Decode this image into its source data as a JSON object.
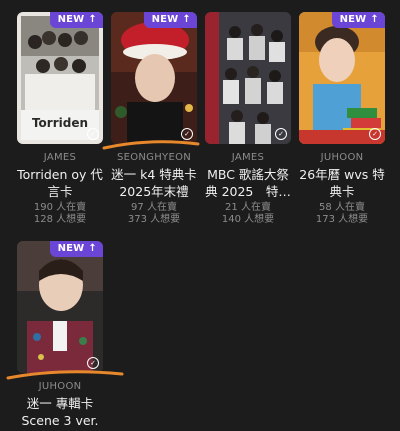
{
  "cards": [
    {
      "badge": "NEW",
      "badge_icon": "arrow-up",
      "member": "JAMES",
      "title": [
        "Torriden oy 代",
        "言卡"
      ],
      "trading": "190 人在賣",
      "wanting": "128 人想要",
      "photo_label": "Torriden"
    },
    {
      "badge": "NEW",
      "badge_icon": "arrow-up",
      "member": "SEONGHYEON",
      "title": [
        "迷一 k4 特典卡",
        "2025年末禮"
      ],
      "trading": "97 人在賣",
      "wanting": "373 人想要"
    },
    {
      "badge": "",
      "member": "JAMES",
      "title": [
        "MBC 歌謠大祭",
        "典 2025　特…"
      ],
      "trading": "21 人在賣",
      "wanting": "140 人想要"
    },
    {
      "badge": "NEW",
      "badge_icon": "arrow-up",
      "member": "JUHOON",
      "title": [
        "26年曆 wvs 特",
        "典卡"
      ],
      "trading": "58 人在賣",
      "wanting": "173 人想要"
    },
    {
      "badge": "NEW",
      "badge_icon": "arrow-up",
      "member": "JUHOON",
      "title": [
        "迷一 專輯卡",
        "Scene 3 ver."
      ],
      "trading": "",
      "wanting": ""
    }
  ],
  "colors": {
    "background": "#1c1c1c",
    "badge": "#6b46d6",
    "highlight": "#e8882c"
  }
}
